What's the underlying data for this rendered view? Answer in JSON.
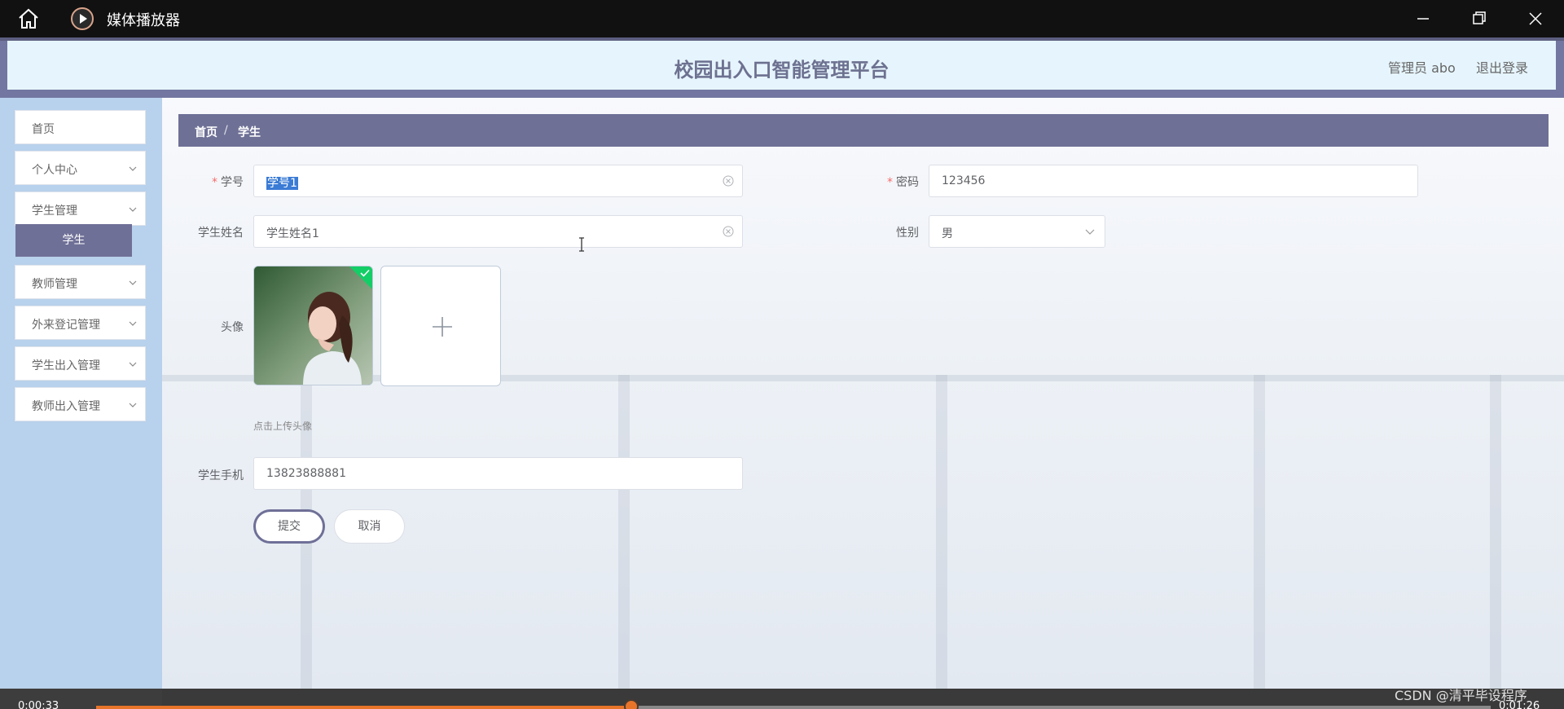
{
  "window": {
    "title": "媒体播放器"
  },
  "header": {
    "title": "校园出入口智能管理平台",
    "user": "管理员 abo",
    "logout": "退出登录"
  },
  "sidebar": {
    "items": [
      {
        "label": "首页"
      },
      {
        "label": "个人中心"
      },
      {
        "label": "学生管理"
      },
      {
        "label": "教师管理"
      },
      {
        "label": "外来登记管理"
      },
      {
        "label": "学生出入管理"
      },
      {
        "label": "教师出入管理"
      }
    ],
    "active_sub": "学生"
  },
  "breadcrumb": {
    "home": "首页",
    "separator": "/",
    "current": "学生"
  },
  "form": {
    "student_id": {
      "label": "学号",
      "value": "学号1"
    },
    "password": {
      "label": "密码",
      "value": "123456"
    },
    "student_name": {
      "label": "学生姓名",
      "value": "学生姓名1"
    },
    "gender": {
      "label": "性别",
      "value": "男"
    },
    "avatar": {
      "label": "头像",
      "hint": "点击上传头像"
    },
    "phone": {
      "label": "学生手机",
      "value": "13823888881"
    },
    "submit": "提交",
    "cancel": "取消"
  },
  "player": {
    "elapsed": "0:00:33",
    "total": "0:01:26",
    "progress": 0.384
  },
  "watermark": "CSDN @清平毕设程序",
  "colors": {
    "accent": "#6e7096",
    "sidebar_bg": "#b8d1ec",
    "header_bg": "#e6f5fd",
    "progress": "#e8742a"
  }
}
